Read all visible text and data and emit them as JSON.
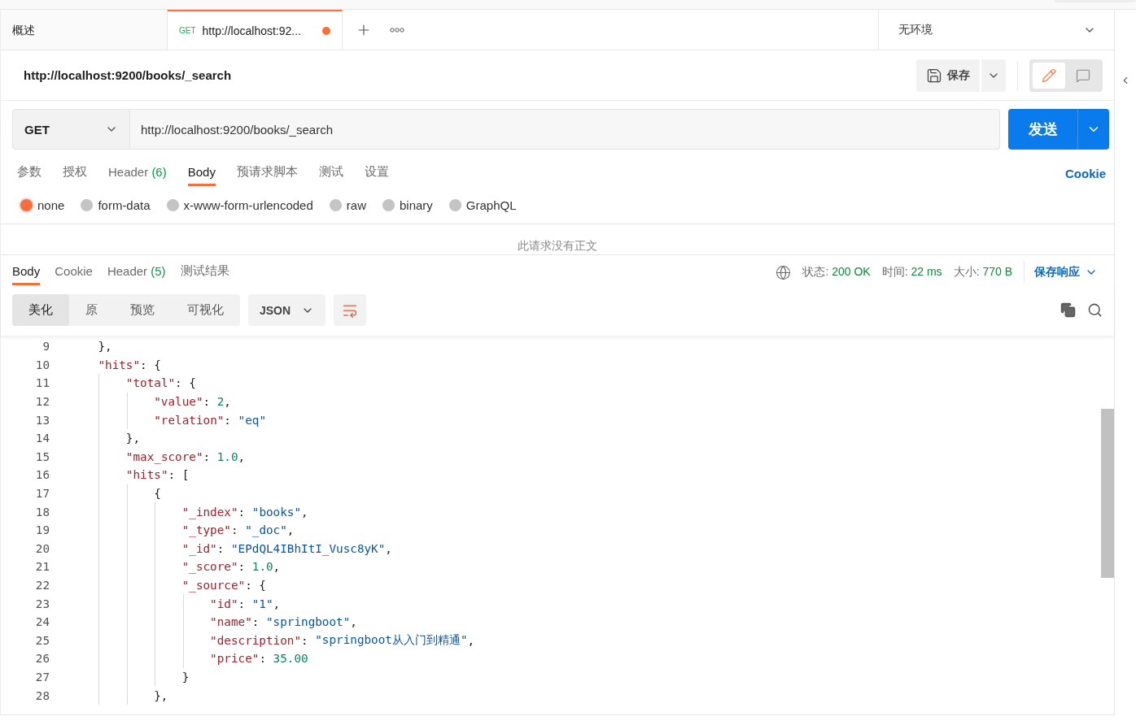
{
  "tabs": [
    {
      "kind": "overview",
      "label": "概述",
      "selected": false
    },
    {
      "kind": "request",
      "method": "GET",
      "label": "http://localhost:92...",
      "selected": true,
      "unsaved": true
    }
  ],
  "environment": {
    "label": "无环境"
  },
  "request": {
    "title": "http://localhost:9200/books/_search",
    "save_label": "保存",
    "method": "GET",
    "url": "http://localhost:9200/books/_search",
    "send_label": "发送"
  },
  "request_tabs": [
    {
      "label": "参数",
      "selected": false
    },
    {
      "label": "授权",
      "selected": false
    },
    {
      "label": "Header",
      "count": "(6)",
      "selected": false
    },
    {
      "label": "Body",
      "selected": true
    },
    {
      "label": "预请求脚本",
      "selected": false
    },
    {
      "label": "测试",
      "selected": false
    },
    {
      "label": "设置",
      "selected": false
    }
  ],
  "cookie_link": "Cookie",
  "body_types": [
    {
      "label": "none",
      "selected": true
    },
    {
      "label": "form-data",
      "selected": false
    },
    {
      "label": "x-www-form-urlencoded",
      "selected": false
    },
    {
      "label": "raw",
      "selected": false
    },
    {
      "label": "binary",
      "selected": false
    },
    {
      "label": "GraphQL",
      "selected": false
    }
  ],
  "empty_body_message": "此请求没有正文",
  "response_tabs": [
    {
      "label": "Body",
      "selected": true
    },
    {
      "label": "Cookie",
      "selected": false
    },
    {
      "label": "Header",
      "count": "(5)",
      "selected": false
    },
    {
      "label": "测试结果",
      "selected": false
    }
  ],
  "response_meta": [
    {
      "label": "状态:",
      "value": "200 OK"
    },
    {
      "label": "时间:",
      "value": "22 ms"
    },
    {
      "label": "大小:",
      "value": "770 B"
    }
  ],
  "save_response": "保存响应",
  "view_modes": [
    {
      "label": "美化",
      "selected": true
    },
    {
      "label": "原",
      "selected": false
    },
    {
      "label": "预览",
      "selected": false
    },
    {
      "label": "可视化",
      "selected": false
    }
  ],
  "format": "JSON",
  "code_lines": [
    {
      "number": "9",
      "tokens": [
        {
          "kind": "punct",
          "text": "},"
        }
      ]
    },
    {
      "number": "10",
      "tokens": [
        {
          "kind": "key",
          "text": "\"hits\""
        },
        {
          "kind": "punct",
          "text": ": {"
        }
      ],
      "children": [
        {
          "number": "11",
          "tokens": [
            {
              "kind": "key",
              "text": "\"total\""
            },
            {
              "kind": "punct",
              "text": ": {"
            }
          ],
          "children": [
            {
              "number": "12",
              "tokens": [
                {
                  "kind": "key",
                  "text": "\"value\""
                },
                {
                  "kind": "punct",
                  "text": ": "
                },
                {
                  "kind": "number",
                  "text": "2"
                },
                {
                  "kind": "punct",
                  "text": ","
                }
              ]
            },
            {
              "number": "13",
              "tokens": [
                {
                  "kind": "key",
                  "text": "\"relation\""
                },
                {
                  "kind": "punct",
                  "text": ": "
                },
                {
                  "kind": "string",
                  "text": "\"eq\""
                }
              ]
            }
          ]
        },
        {
          "number": "14",
          "tokens": [
            {
              "kind": "punct",
              "text": "},"
            }
          ]
        },
        {
          "number": "15",
          "tokens": [
            {
              "kind": "key",
              "text": "\"max_score\""
            },
            {
              "kind": "punct",
              "text": ": "
            },
            {
              "kind": "number",
              "text": "1.0"
            },
            {
              "kind": "punct",
              "text": ","
            }
          ]
        },
        {
          "number": "16",
          "tokens": [
            {
              "kind": "key",
              "text": "\"hits\""
            },
            {
              "kind": "punct",
              "text": ": ["
            }
          ],
          "children": [
            {
              "number": "17",
              "tokens": [
                {
                  "kind": "punct",
                  "text": "{"
                }
              ],
              "children": [
                {
                  "number": "18",
                  "tokens": [
                    {
                      "kind": "key",
                      "text": "\"_index\""
                    },
                    {
                      "kind": "punct",
                      "text": ": "
                    },
                    {
                      "kind": "string",
                      "text": "\"books\""
                    },
                    {
                      "kind": "punct",
                      "text": ","
                    }
                  ]
                },
                {
                  "number": "19",
                  "tokens": [
                    {
                      "kind": "key",
                      "text": "\"_type\""
                    },
                    {
                      "kind": "punct",
                      "text": ": "
                    },
                    {
                      "kind": "string",
                      "text": "\"_doc\""
                    },
                    {
                      "kind": "punct",
                      "text": ","
                    }
                  ]
                },
                {
                  "number": "20",
                  "tokens": [
                    {
                      "kind": "key",
                      "text": "\"_id\""
                    },
                    {
                      "kind": "punct",
                      "text": ": "
                    },
                    {
                      "kind": "string",
                      "text": "\"EPdQL4IBhItI_Vusc8yK\""
                    },
                    {
                      "kind": "punct",
                      "text": ","
                    }
                  ]
                },
                {
                  "number": "21",
                  "tokens": [
                    {
                      "kind": "key",
                      "text": "\"_score\""
                    },
                    {
                      "kind": "punct",
                      "text": ": "
                    },
                    {
                      "kind": "number",
                      "text": "1.0"
                    },
                    {
                      "kind": "punct",
                      "text": ","
                    }
                  ]
                },
                {
                  "number": "22",
                  "tokens": [
                    {
                      "kind": "key",
                      "text": "\"_source\""
                    },
                    {
                      "kind": "punct",
                      "text": ": {"
                    }
                  ],
                  "children": [
                    {
                      "number": "23",
                      "tokens": [
                        {
                          "kind": "key",
                          "text": "\"id\""
                        },
                        {
                          "kind": "punct",
                          "text": ": "
                        },
                        {
                          "kind": "string",
                          "text": "\"1\""
                        },
                        {
                          "kind": "punct",
                          "text": ","
                        }
                      ]
                    },
                    {
                      "number": "24",
                      "tokens": [
                        {
                          "kind": "key",
                          "text": "\"name\""
                        },
                        {
                          "kind": "punct",
                          "text": ": "
                        },
                        {
                          "kind": "string",
                          "text": "\"springboot\""
                        },
                        {
                          "kind": "punct",
                          "text": ","
                        }
                      ]
                    },
                    {
                      "number": "25",
                      "tokens": [
                        {
                          "kind": "key",
                          "text": "\"description\""
                        },
                        {
                          "kind": "punct",
                          "text": ": "
                        },
                        {
                          "kind": "string",
                          "text": "\"springboot从入门到精通\""
                        },
                        {
                          "kind": "punct",
                          "text": ","
                        }
                      ]
                    },
                    {
                      "number": "26",
                      "tokens": [
                        {
                          "kind": "key",
                          "text": "\"price\""
                        },
                        {
                          "kind": "punct",
                          "text": ": "
                        },
                        {
                          "kind": "number",
                          "text": "35.00"
                        }
                      ]
                    }
                  ]
                },
                {
                  "number": "27",
                  "tokens": [
                    {
                      "kind": "punct",
                      "text": "}"
                    }
                  ]
                }
              ]
            },
            {
              "number": "28",
              "tokens": [
                {
                  "kind": "punct",
                  "text": "},"
                }
              ]
            }
          ]
        }
      ]
    }
  ]
}
